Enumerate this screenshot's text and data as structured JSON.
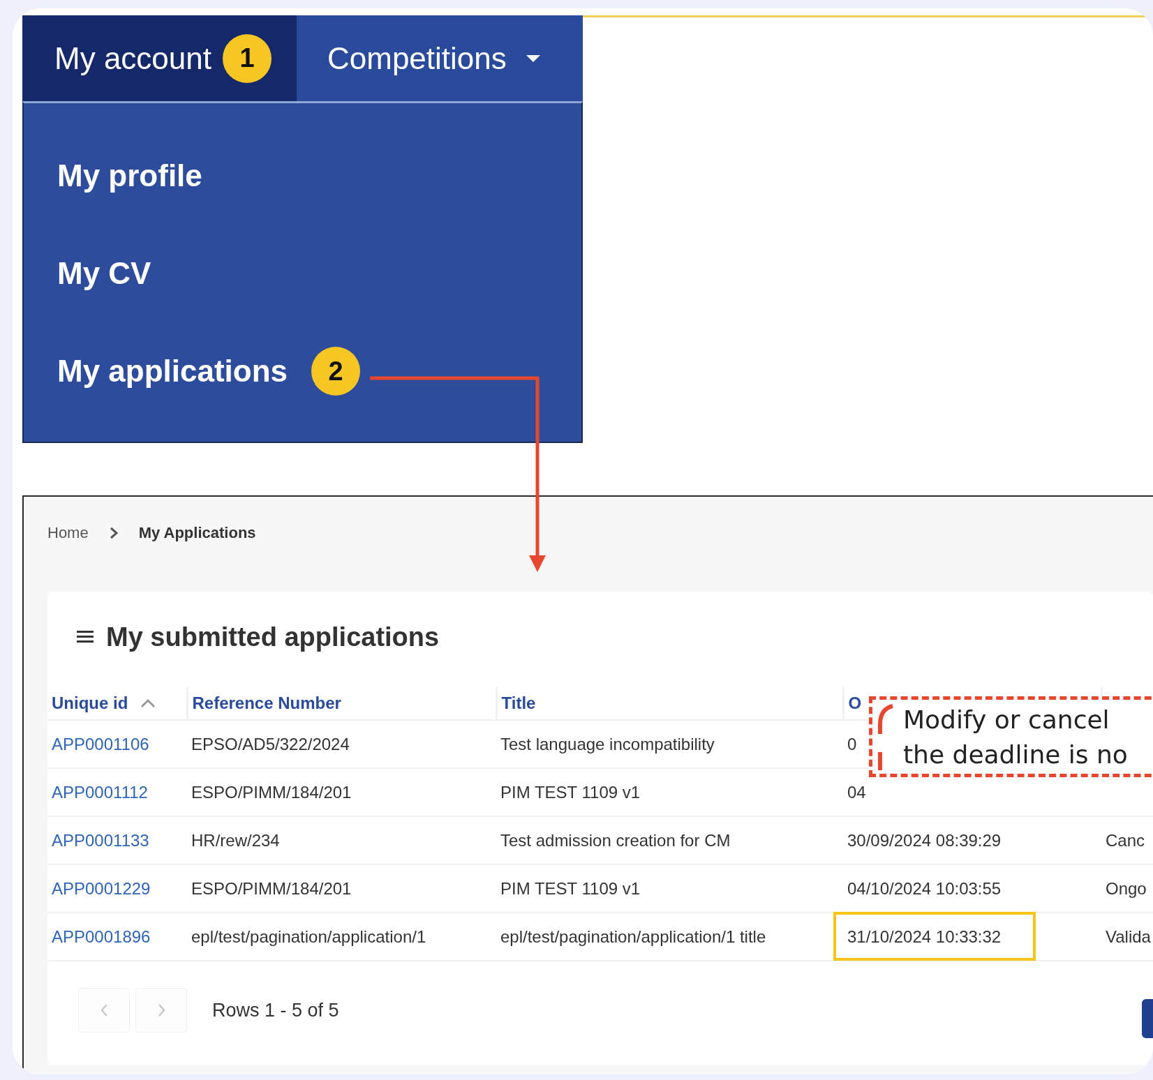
{
  "nav": {
    "tabs": [
      {
        "label": "My account",
        "selected": true,
        "badge": "1",
        "dropdown": false
      },
      {
        "label": "Competitions",
        "selected": false,
        "dropdown": true
      }
    ],
    "menu": [
      {
        "label": "My profile"
      },
      {
        "label": "My CV"
      },
      {
        "label": "My applications",
        "badge": "2"
      }
    ]
  },
  "panel": {
    "breadcrumb": [
      "Home",
      "My Applications"
    ],
    "title": "My submitted applications",
    "columns": [
      {
        "label": "Unique id",
        "sorted": true
      },
      {
        "label": "Reference Number",
        "sorted": false
      },
      {
        "label": "Title",
        "sorted": false
      },
      {
        "label": "O",
        "sorted": false
      }
    ],
    "rows": [
      {
        "cells": [
          "APP0001106",
          "EPSO/AD5/322/2024",
          "Test language incompatibility",
          "0",
          ""
        ],
        "highlighted": false
      },
      {
        "cells": [
          "APP0001112",
          "ESPO/PIMM/184/201",
          "PIM TEST 1109 v1",
          "04",
          ""
        ],
        "highlighted": false
      },
      {
        "cells": [
          "APP0001133",
          "HR/rew/234",
          "Test admission creation for CM",
          "30/09/2024 08:39:29",
          "Canc"
        ],
        "highlighted": false
      },
      {
        "cells": [
          "APP0001229",
          "ESPO/PIMM/184/201",
          "PIM TEST 1109 v1",
          "04/10/2024 10:03:55",
          "Ongo"
        ],
        "highlighted": false
      },
      {
        "cells": [
          "APP0001896",
          "epl/test/pagination/application/1",
          "epl/test/pagination/application/1 title",
          "31/10/2024 10:33:32",
          "Valida"
        ],
        "highlighted": true
      }
    ],
    "pagination": {
      "prev_disabled": true,
      "next_disabled": true,
      "summary": "Rows 1 - 5 of 5"
    }
  },
  "callout": {
    "lines": [
      "Modify or cancel",
      "the deadline is no"
    ]
  }
}
